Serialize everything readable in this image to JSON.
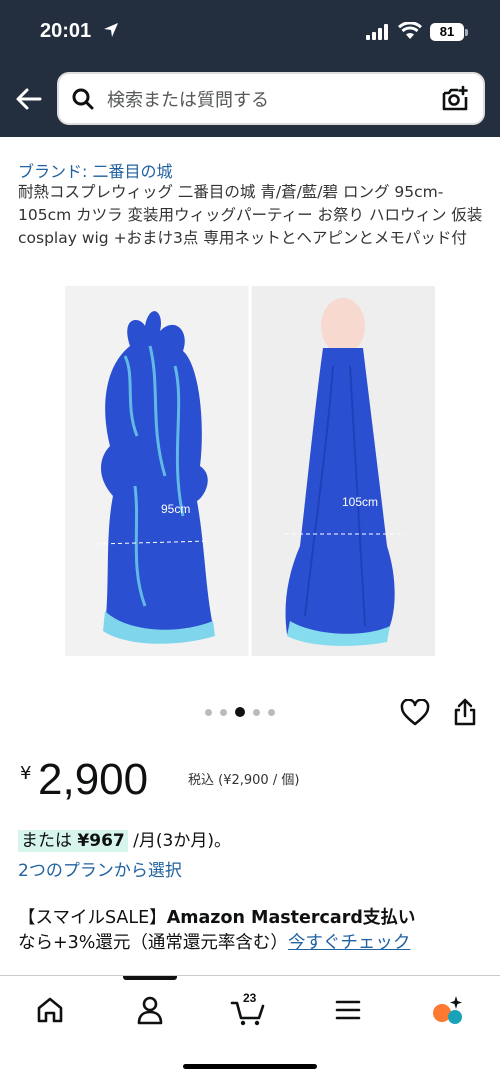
{
  "status": {
    "time": "20:01",
    "battery": "81"
  },
  "search": {
    "placeholder": "検索または質問する"
  },
  "product": {
    "brand": "ブランド: 二番目の城",
    "title": "耐熱コスプレウィッグ 二番目の城 青/蒼/藍/碧 ロング 95cm-105cm カツラ 変装用ウィッグパーティー お祭り ハロウィン 仮装 cosplay wig +おまけ3点 専用ネットとヘアピンとメモパッド付",
    "image_labels": {
      "left": "95cm",
      "right": "105cm"
    },
    "carousel": {
      "count": 5,
      "active": 3
    }
  },
  "price": {
    "symbol": "¥",
    "amount": "2,900",
    "tax_note": "税込 (¥2,900 / 個)"
  },
  "installment": {
    "prefix": "または",
    "amount": "¥967",
    "suffix": "/月(3か月)。",
    "plan_link": "2つのプランから選択"
  },
  "promo": {
    "tag": "【スマイルSALE】",
    "bold": "Amazon Mastercard支払い",
    "rest": "なら+3%還元（通常還元率含む）",
    "link": "今すぐチェック"
  },
  "nav": {
    "cart_count": "23"
  },
  "colors": {
    "header": "#232f3e",
    "link": "#2162a1",
    "highlight": "#d7f5ec",
    "wig_blue": "#2a4fd0"
  }
}
